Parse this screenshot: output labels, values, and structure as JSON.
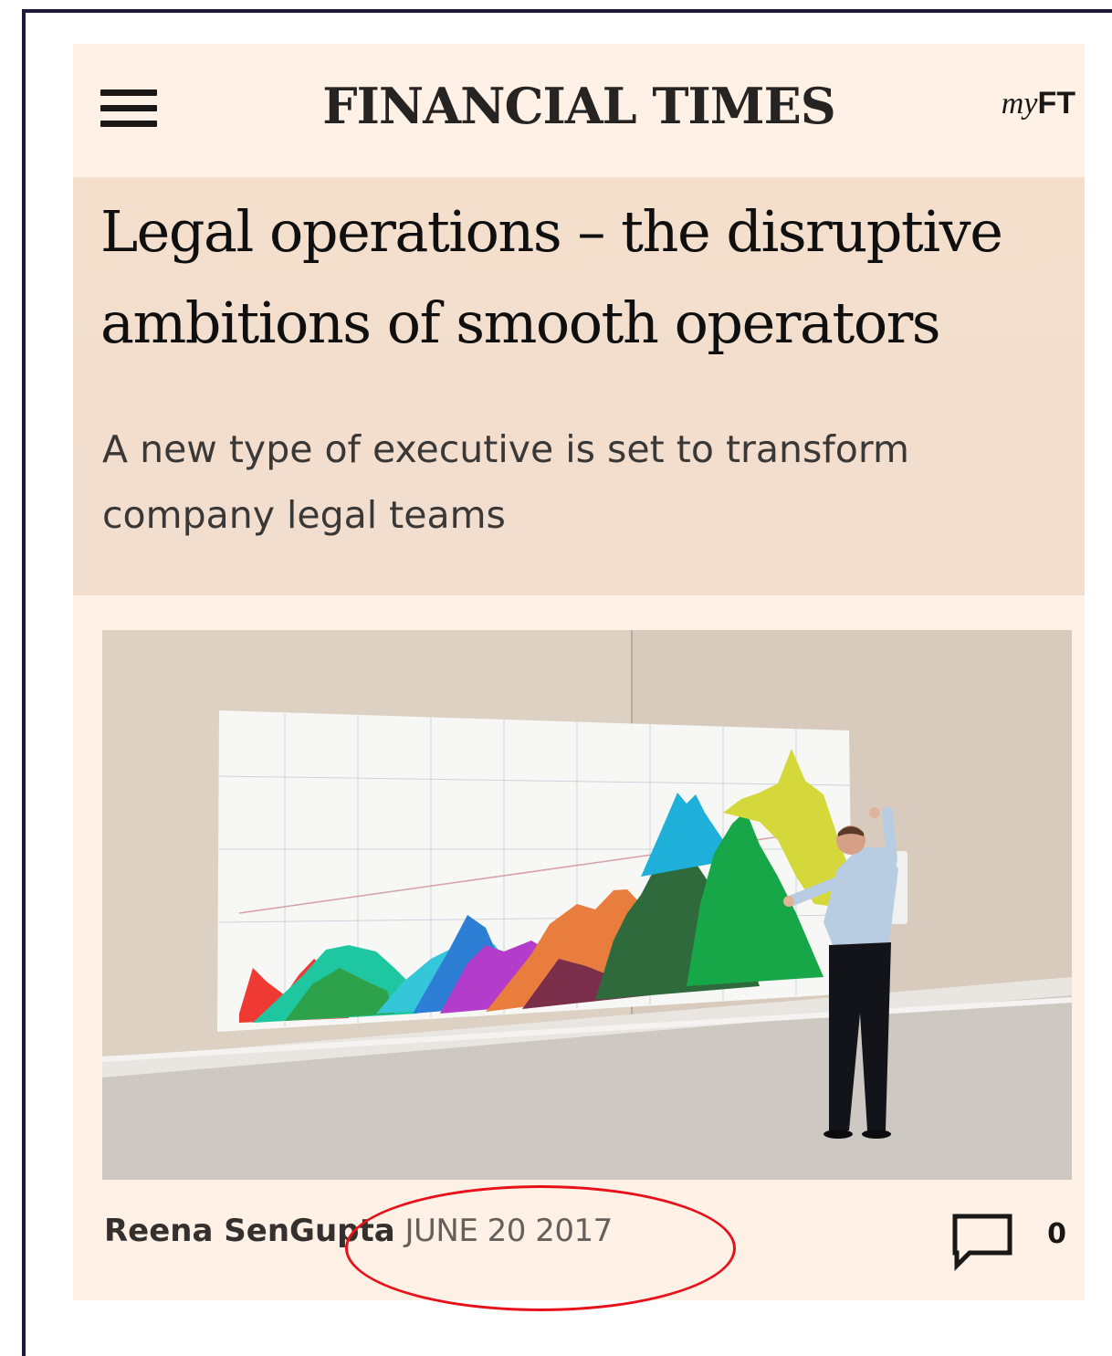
{
  "header": {
    "brand": "FINANCIAL TIMES",
    "myft_prefix": "my",
    "myft_suffix": "FT",
    "menu_icon": "hamburger-menu-icon"
  },
  "article": {
    "headline": "Legal operations – the disruptive ambitions of smooth operators",
    "standfirst": "A new type of executive is set to transform company legal teams",
    "image_icon": "article-photo",
    "author": "Reena SenGupta",
    "date": "JUNE 20 2017",
    "comment_icon": "comment-icon",
    "comment_count": "0"
  },
  "colors": {
    "page_background": "#fff1e5",
    "hero_background": "#f2decf",
    "annotation": "#e8111a"
  }
}
